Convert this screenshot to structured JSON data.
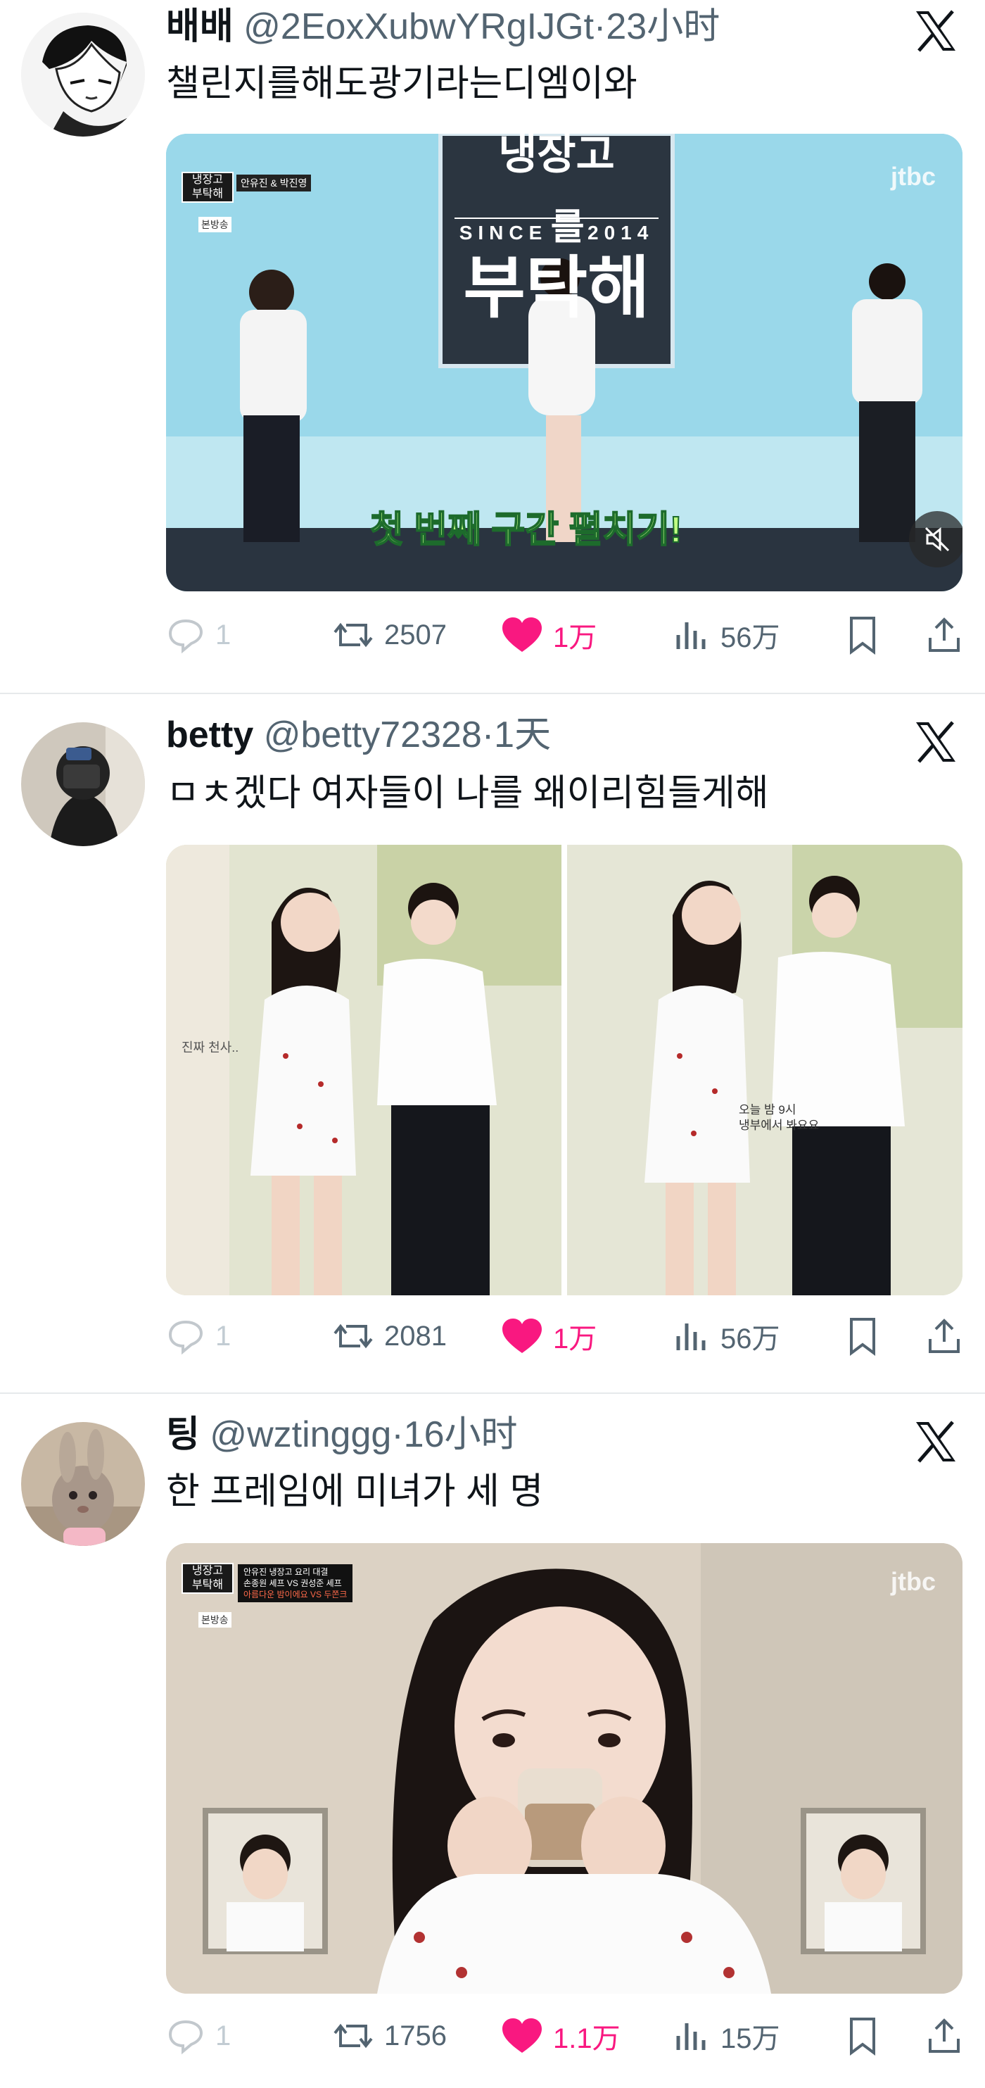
{
  "tweets": [
    {
      "display_name": "배배",
      "handle": "@2EoxXubwYRgIJGt",
      "separator": "·",
      "time": "23小时",
      "text": "챌린지를해도광기라는디엠이와",
      "media": {
        "broadcaster": "jtbc",
        "show_logo": [
          "냉장고",
          "부탁해"
        ],
        "guest_tag": "안유진 & 박진영",
        "badge": "본방송",
        "set_sign": [
          "SINCE",
          "를",
          "2014",
          "부탁해"
        ],
        "caption": "첫 번째 구간 펼치기!"
      },
      "stats": {
        "replies": "1",
        "retweets": "2507",
        "likes": "1万",
        "views": "56万"
      }
    },
    {
      "display_name": "betty",
      "handle": "@betty72328",
      "separator": "·",
      "time": "1天",
      "text": "ㅁㅊ겠다 여자들이 나를 왜이리힘들게해",
      "media": {
        "left_overlay": "진짜 천사..",
        "right_overlay": [
          "오늘 밤 9시",
          "냉부에서 봐요요"
        ]
      },
      "stats": {
        "replies": "1",
        "retweets": "2081",
        "likes": "1万",
        "views": "56万"
      }
    },
    {
      "display_name": "팅",
      "handle": "@wztinggg",
      "separator": "·",
      "time": "16小时",
      "text": "한 프레임에 미녀가 세 명",
      "media": {
        "broadcaster": "jtbc",
        "show_logo": [
          "냉장고",
          "부탁해"
        ],
        "badge": "본방송",
        "info_lines": [
          "안유진 냉장고 요리 대결",
          "손종원 셰프 VS 권성준 셰프",
          "아름다운 밤이에요 VS 두쫀크"
        ]
      },
      "stats": {
        "replies": "1",
        "retweets": "1756",
        "likes": "1.1万",
        "views": "15万"
      }
    }
  ],
  "icons": {
    "platform": "x-logo-icon",
    "reply": "reply-icon",
    "retweet": "retweet-icon",
    "like": "heart-icon",
    "views": "views-icon",
    "bookmark": "bookmark-icon",
    "share": "share-icon",
    "mute": "muted-speaker-icon"
  },
  "colors": {
    "like": "#f91880",
    "meta": "#536471",
    "text": "#0f1419",
    "divider": "#e6e9eb"
  }
}
